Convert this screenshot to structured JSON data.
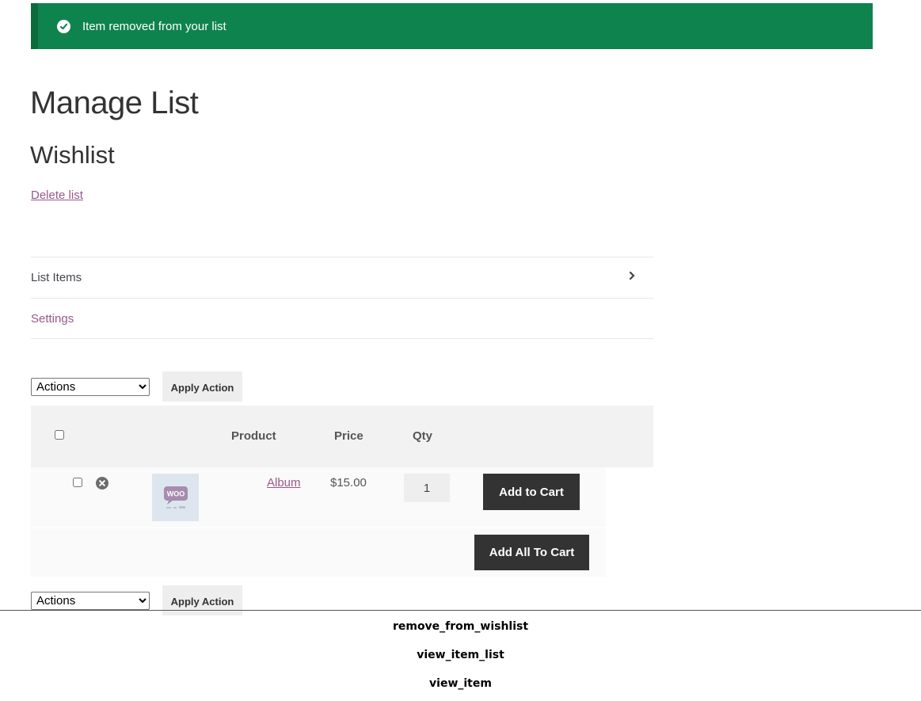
{
  "notice": {
    "text": "Item removed from your list",
    "icon": "check-circle-icon",
    "color": "#0f834d"
  },
  "page": {
    "title": "Manage List",
    "list_name": "Wishlist",
    "delete_link": "Delete list"
  },
  "tabs": [
    {
      "label": "List Items",
      "active": true
    },
    {
      "label": "Settings",
      "active": false
    }
  ],
  "bulk_actions": {
    "selected": "Actions",
    "apply_label": "Apply Action"
  },
  "table": {
    "columns": {
      "product": "Product",
      "price": "Price",
      "qty": "Qty"
    },
    "rows": [
      {
        "product": "Album",
        "price": "$15.00",
        "qty": "1",
        "add_label": "Add to Cart",
        "thumb_text": "WOO"
      }
    ],
    "add_all_label": "Add All To Cart"
  },
  "events": [
    "remove_from_wishlist",
    "view_item_list",
    "view_item"
  ],
  "colors": {
    "link": "#96588a",
    "button_dark": "#333333",
    "notice_bg": "#0f834d"
  }
}
